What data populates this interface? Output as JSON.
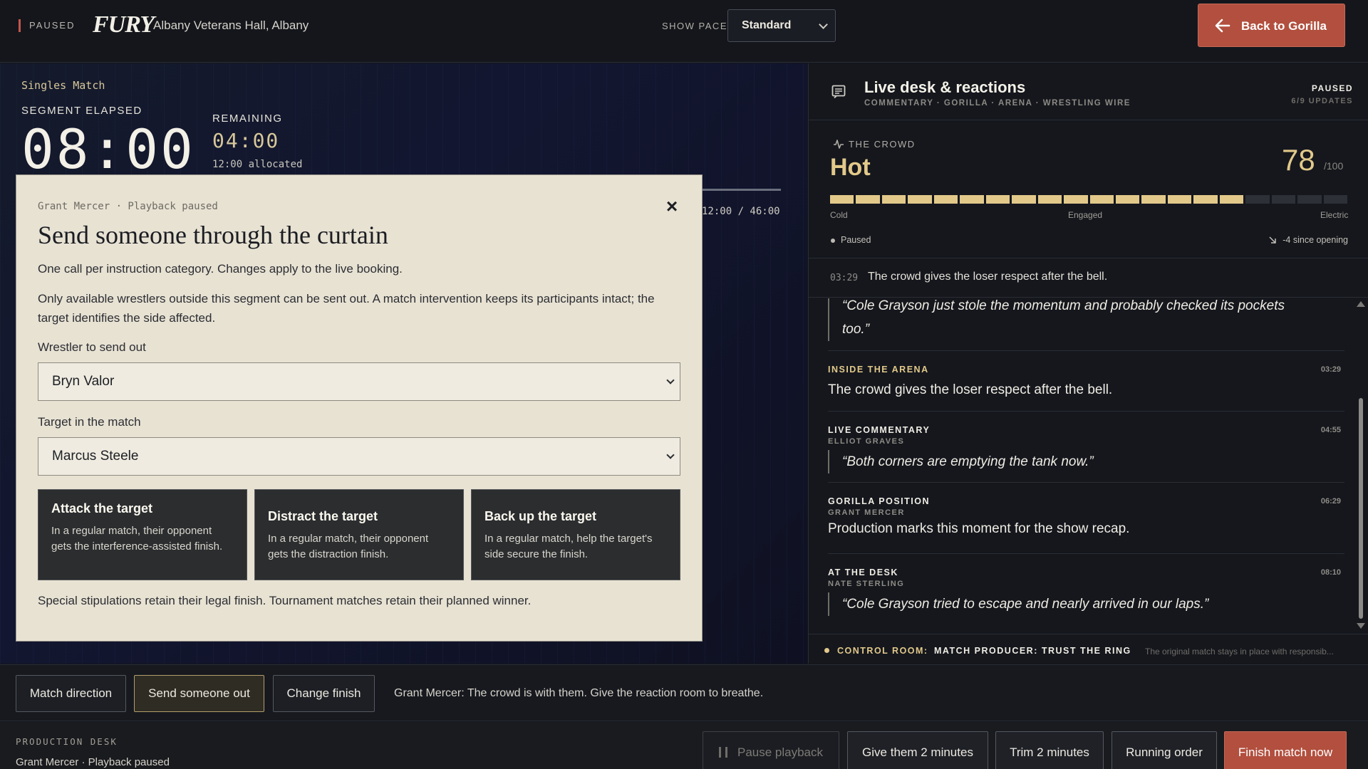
{
  "topbar": {
    "status": "PAUSED",
    "logo": "FURY",
    "venue": "Albany Veterans Hall, Albany",
    "pace_label": "SHOW PACE",
    "pace_value": "Standard",
    "back_button": "Back to Gorilla"
  },
  "stage": {
    "match_type": "Singles Match",
    "segment_label": "SEGMENT ELAPSED",
    "segment_time": "08:00",
    "remaining_label": "REMAINING",
    "remaining_time": "04:00",
    "allocated": "12:00 allocated",
    "runtime": "12:00 / 46:00"
  },
  "modal": {
    "meta": "Grant Mercer · Playback paused",
    "close": "×",
    "title": "Send someone through the curtain",
    "intro": "One call per instruction category. Changes apply to the live booking.",
    "note": "Only available wrestlers outside this segment can be sent out. A match intervention keeps its participants intact; the target identifies the side affected.",
    "wrestler_label": "Wrestler to send out",
    "wrestler_value": "Bryn Valor",
    "target_label": "Target in the match",
    "target_value": "Marcus Steele",
    "options": [
      {
        "title": "Attack the target",
        "desc": "In a regular match, their opponent gets the interference-assisted finish."
      },
      {
        "title": "Distract the target",
        "desc": "In a regular match, their opponent gets the distraction finish."
      },
      {
        "title": "Back up the target",
        "desc": "In a regular match, help the target's side secure the finish."
      }
    ],
    "footnote": "Special stipulations retain their legal finish. Tournament matches retain their planned winner."
  },
  "panel": {
    "title": "Live desk & reactions",
    "subtitle": "COMMENTARY · GORILLA · ARENA · WRESTLING WIRE",
    "status": "PAUSED",
    "updates": "6/9 UPDATES",
    "crowd": {
      "label": "THE CROWD",
      "mood": "Hot",
      "score": 78,
      "score_display": "78",
      "max": "/100",
      "scale": [
        "Cold",
        "Engaged",
        "Electric"
      ],
      "state": "Paused",
      "since": "-4 since opening",
      "note_time": "03:29",
      "note_text": "The crowd gives the loser respect after the bell."
    },
    "feed": [
      {
        "quote": "“Cole Grayson just stole the momentum and probably checked its pockets too.”"
      },
      {
        "category": "INSIDE THE ARENA",
        "time": "03:29",
        "text": "The crowd gives the loser respect after the bell."
      },
      {
        "category": "LIVE COMMENTARY",
        "author": "ELLIOT GRAVES",
        "time": "04:55",
        "quote": "“Both corners are emptying the tank now.”"
      },
      {
        "category": "GORILLA POSITION",
        "author": "GRANT MERCER",
        "time": "06:29",
        "text": "Production marks this moment for the show recap."
      },
      {
        "category": "AT THE DESK",
        "author": "NATE STERLING",
        "time": "08:10",
        "quote": "“Cole Grayson tried to escape and nearly arrived in our laps.”"
      }
    ],
    "control_room": {
      "label": "CONTROL ROOM:",
      "text": "MATCH PRODUCER: TRUST THE RING",
      "sub": "The original match stays in place with responsib..."
    }
  },
  "actionbar": {
    "buttons": [
      "Match direction",
      "Send someone out",
      "Change finish"
    ],
    "active": "Send someone out",
    "note": "Grant Mercer: The crowd is with them. Give the reaction room to breathe."
  },
  "footer": {
    "label": "PRODUCTION DESK",
    "sub": "Grant Mercer · Playback paused",
    "pause": "Pause playback",
    "give": "Give them 2 minutes",
    "trim": "Trim 2 minutes",
    "order": "Running order",
    "finish": "Finish match now"
  },
  "colors": {
    "accent_gold": "#e2c98a",
    "danger": "#b24f3e",
    "modal_bg": "#e8e2d3"
  }
}
